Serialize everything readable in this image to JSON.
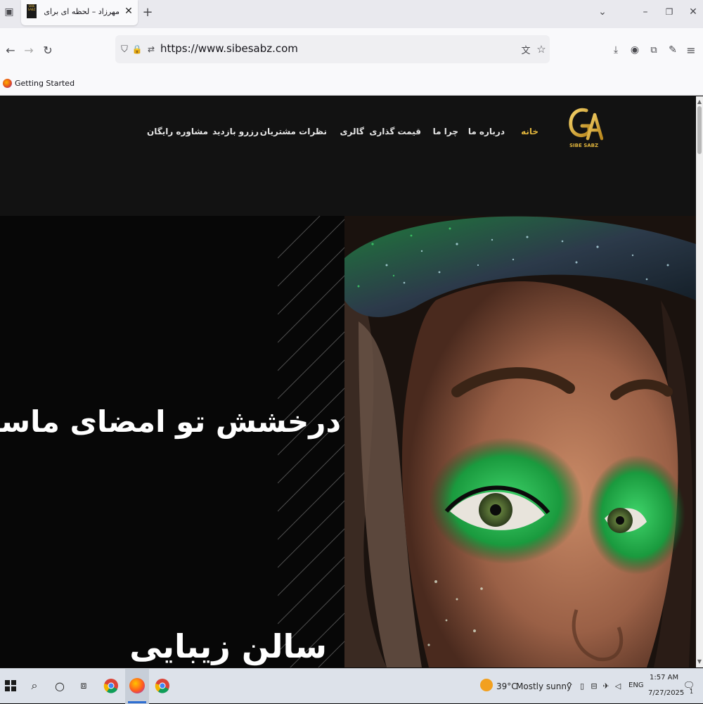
{
  "browser": {
    "tab": {
      "title": "مهرزاد – لحظه ای برای عشق",
      "favicon_label": "SIBE SABZ"
    },
    "url": "https://www.sibesabz.com",
    "bookmarks": [
      {
        "label": "Getting Started"
      }
    ]
  },
  "site": {
    "logo_text": "SIBE SABZ",
    "nav": [
      {
        "label": "خانه",
        "active": true
      },
      {
        "label": "درباره ما"
      },
      {
        "label": "چرا ما"
      },
      {
        "label": "قیمت گذاری"
      },
      {
        "label": "گالری"
      },
      {
        "label": "نظرات مشتریان"
      },
      {
        "label": "رزرو بازدید"
      },
      {
        "label": "مشاوره رایگان"
      }
    ],
    "hero": {
      "title": "درخشش تو امضای ماست",
      "subtitle": "سالن زیبایی"
    },
    "accent_color": "#e0b43c"
  },
  "taskbar": {
    "weather": {
      "temp": "39°C",
      "condition": "Mostly sunny"
    },
    "language": "ENG",
    "time": "1:57 AM",
    "date": "7/27/2025",
    "notification_count": "1"
  }
}
